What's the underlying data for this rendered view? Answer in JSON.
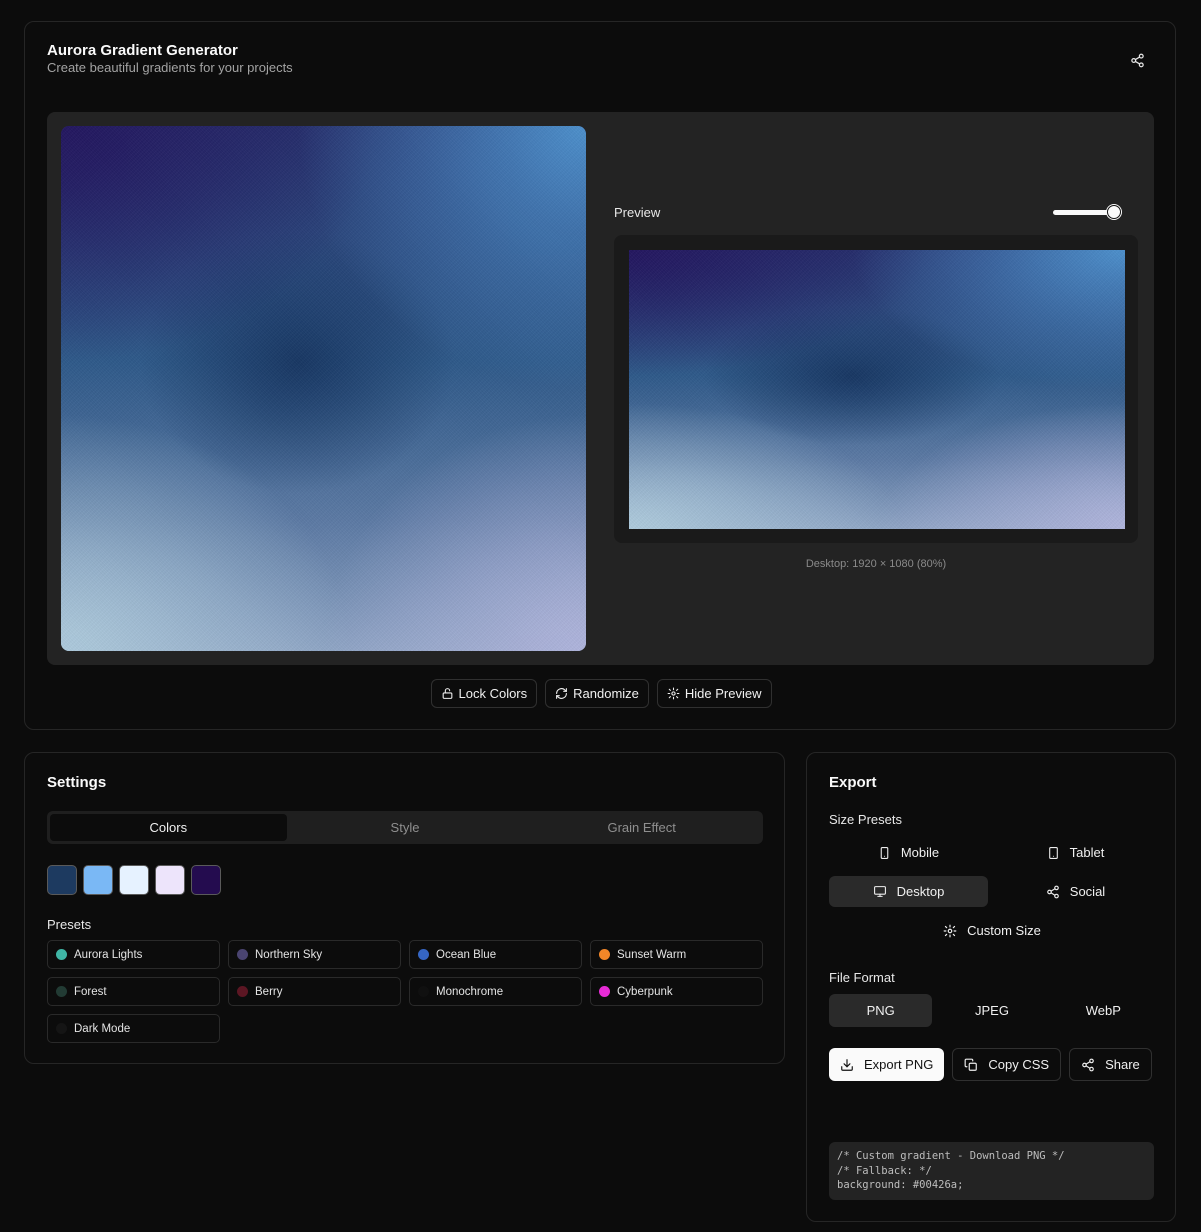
{
  "header": {
    "title": "Aurora Gradient Generator",
    "subtitle": "Create beautiful gradients for your projects",
    "share_icon": "share-icon"
  },
  "preview": {
    "label": "Preview",
    "toggle_on": true,
    "caption": "Desktop: 1920 × 1080 (80%)"
  },
  "actions": {
    "lock_colors": "Lock Colors",
    "randomize": "Randomize",
    "hide_preview": "Hide Preview"
  },
  "settings": {
    "title": "Settings",
    "tabs": [
      {
        "label": "Colors",
        "active": true
      },
      {
        "label": "Style",
        "active": false
      },
      {
        "label": "Grain Effect",
        "active": false
      }
    ],
    "swatches": [
      "#1d3a60",
      "#7ab8f5",
      "#e6f2ff",
      "#ede4fb",
      "#240c4f"
    ],
    "presets_label": "Presets",
    "presets": [
      {
        "label": "Aurora Lights",
        "color": "#3fb5a5"
      },
      {
        "label": "Northern Sky",
        "color": "#4a4470"
      },
      {
        "label": "Ocean Blue",
        "color": "#3566c4"
      },
      {
        "label": "Sunset Warm",
        "color": "#f28628"
      },
      {
        "label": "Forest",
        "color": "#223b34"
      },
      {
        "label": "Berry",
        "color": "#5c1623"
      },
      {
        "label": "Monochrome",
        "color": "#101010"
      },
      {
        "label": "Cyberpunk",
        "color": "#e72bd6"
      },
      {
        "label": "Dark Mode",
        "color": "#151515"
      }
    ]
  },
  "export": {
    "title": "Export",
    "size_presets_label": "Size Presets",
    "sizes": {
      "mobile": "Mobile",
      "tablet": "Tablet",
      "desktop": "Desktop",
      "social": "Social",
      "custom": "Custom Size"
    },
    "file_format_label": "File Format",
    "formats": [
      {
        "label": "PNG",
        "active": true
      },
      {
        "label": "JPEG",
        "active": false
      },
      {
        "label": "WebP",
        "active": false
      }
    ],
    "export_png": "Export PNG",
    "copy_css": "Copy CSS",
    "share": "Share",
    "code": "/* Custom gradient - Download PNG */\n/* Fallback: */\nbackground: #00426a;"
  }
}
